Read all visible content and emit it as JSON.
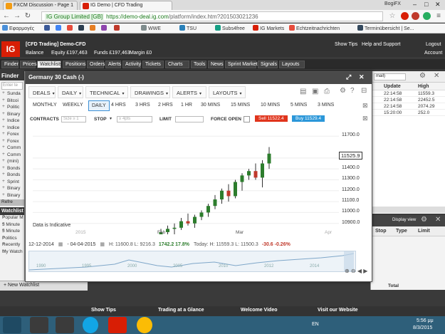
{
  "browser": {
    "tabs": [
      {
        "label": "FXCM Discussion - Page 1"
      },
      {
        "label": "IG Group Limited [GB]"
      },
      {
        "label": "IG Demo | CFD Trading"
      }
    ],
    "user": "BogiFX",
    "url_secure": "IG Group Limited [GB]",
    "url_protocol": "https://",
    "url_host": "demo-deal.ig.com",
    "url_path": "/platform/index.htm?201503021236",
    "bookmarks": [
      "Εφαρμογές",
      "",
      "",
      "",
      "",
      "",
      "",
      "WWE",
      "TSU",
      "Subs4free",
      "IG Markets",
      "Echtzeitnachrichten",
      "Terminübersicht | Se..."
    ]
  },
  "ig": {
    "account_title": "[CFD Trading] Demo-CFD",
    "balance_label": "Balance",
    "equity": "Equity £197,463",
    "funds": "Funds £197,463",
    "margin": "Margin £0",
    "links": [
      "Show Tips",
      "Help and Support",
      "Logout",
      "Account"
    ],
    "nav": [
      "Finder",
      "Prices",
      "Watchlists",
      "Positions",
      "Orders",
      "Alerts",
      "Activity",
      "Tickets",
      "Charts",
      "Tools",
      "News",
      "Sprint Markets",
      "Signals",
      "Layouts"
    ],
    "nav_active": "Watchlists",
    "finder": {
      "title": "Finder",
      "search_placeholder": "Enter te",
      "items": [
        "Sunda",
        "Bitcoi",
        "Politic",
        "Binary",
        "Indice",
        "Indice",
        "Forex",
        "Forex",
        "Comm",
        "Comm",
        "(mini)",
        "Bonds",
        "Bonds",
        "Sprint",
        "Binary",
        "Binary"
      ],
      "refresh": "Refre"
    },
    "watchlist": {
      "title": "Watchlist",
      "items": [
        "Popular M",
        "5 Minute",
        "5 Minute",
        "Politics",
        "Recently",
        "My Watch"
      ],
      "new_label": "New Watchlist"
    },
    "prices_panel": {
      "header_cols": [
        "Update",
        "High"
      ],
      "dropdown": "mail)",
      "rows": [
        {
          "update": "22:14:58",
          "high": "11559.3"
        },
        {
          "update": "22:14:58",
          "high": "22452.5"
        },
        {
          "update": "22:14:58",
          "high": "2074.29"
        },
        {
          "update": "15:20:00",
          "high": "252.0"
        }
      ]
    },
    "positions_panel": {
      "display_view": "Display view",
      "cols": [
        "Stop",
        "Type",
        "Limit"
      ],
      "total": "Total"
    },
    "footer": [
      "Show Tips",
      "Trading at a Glance",
      "Welcome Video",
      "Visit our Website"
    ]
  },
  "chart": {
    "title": "Germany 30 Cash (-)",
    "menus": [
      "DEALS",
      "DAILY",
      "TECHNICAL",
      "DRAWINGS",
      "ALERTS",
      "LAYOUTS"
    ],
    "timeframes": [
      "MONTHLY",
      "WEEKLY",
      "DAILY",
      "4 HRS",
      "3 HRS",
      "2 HRS",
      "1 HR",
      "30 MINS",
      "15 MINS",
      "10 MINS",
      "5 MINS",
      "3 MINS"
    ],
    "active_tf": "DAILY",
    "contracts_label": "CONTRACTS",
    "size_placeholder": "Size ≥ 1",
    "stop_label": "STOP",
    "stop_placeholder": "≥ 4pts",
    "limit_label": "LIMIT",
    "force_open_label": "FORCE OPEN",
    "sell_label": "Sell 11522.4",
    "buy_label": "Buy 11529.4",
    "indicative": "Data is Indicative",
    "date_from": "12-12-2014",
    "date_to": "04-04-2015",
    "ohlc": "H: 11600.8  L: 9216.3",
    "change": "1742.2  17.8%",
    "today": "Today: H: 11559.3  L: 11500.3",
    "today_change": "-30.6  -0.26%",
    "nav_years": [
      "1990",
      "1995",
      "2000",
      "2005",
      "2010",
      "2012",
      "2014"
    ],
    "x_labels": [
      "2015",
      "Feb",
      "Mar",
      "Apr"
    ]
  },
  "chart_data": {
    "type": "candlestick",
    "y_ticks": [
      11700,
      11500,
      11400,
      11300,
      11200,
      11100,
      11000,
      10900
    ],
    "current_price": 11525.9,
    "ylim": [
      10800,
      11780
    ],
    "candles": [
      {
        "o": 10800,
        "h": 10850,
        "l": 10700,
        "c": 10820
      },
      {
        "o": 10820,
        "h": 10880,
        "l": 10780,
        "c": 10850
      },
      {
        "o": 10850,
        "h": 10900,
        "l": 10800,
        "c": 10860
      },
      {
        "o": 10860,
        "h": 10950,
        "l": 10840,
        "c": 10920
      },
      {
        "o": 10920,
        "h": 10990,
        "l": 10880,
        "c": 10900
      },
      {
        "o": 10900,
        "h": 10980,
        "l": 10860,
        "c": 10960
      },
      {
        "o": 10960,
        "h": 11020,
        "l": 10930,
        "c": 11000
      },
      {
        "o": 11000,
        "h": 11080,
        "l": 10960,
        "c": 11060
      },
      {
        "o": 11060,
        "h": 11160,
        "l": 11030,
        "c": 11120
      },
      {
        "o": 11120,
        "h": 11220,
        "l": 11080,
        "c": 11200
      },
      {
        "o": 11200,
        "h": 11260,
        "l": 11100,
        "c": 11150
      },
      {
        "o": 11150,
        "h": 11300,
        "l": 11130,
        "c": 11280
      },
      {
        "o": 11280,
        "h": 11360,
        "l": 11200,
        "c": 11340
      },
      {
        "o": 11340,
        "h": 11400,
        "l": 11300,
        "c": 11380
      },
      {
        "o": 11380,
        "h": 11450,
        "l": 11300,
        "c": 11320
      },
      {
        "o": 11320,
        "h": 11480,
        "l": 11230,
        "c": 11450
      },
      {
        "o": 11450,
        "h": 11600,
        "l": 11400,
        "c": 11540
      }
    ],
    "colors": {
      "up": "#2d7d2d",
      "down": "#c0392b"
    }
  }
}
